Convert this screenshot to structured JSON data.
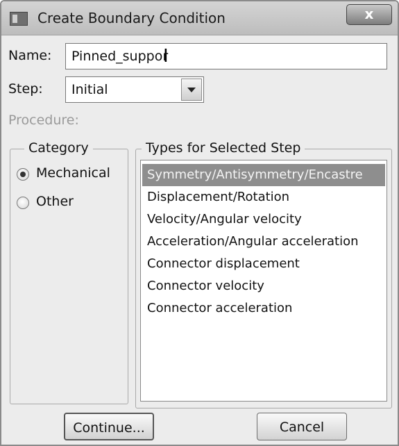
{
  "window": {
    "title": "Create Boundary Condition",
    "close_label": "x"
  },
  "form": {
    "name_label": "Name:",
    "name_value": "Pinned_suppor",
    "step_label": "Step:",
    "step_value": "Initial",
    "procedure_label": "Procedure:"
  },
  "category": {
    "title": "Category",
    "options": [
      {
        "label": "Mechanical",
        "selected": true
      },
      {
        "label": "Other",
        "selected": false
      }
    ]
  },
  "types": {
    "title": "Types for Selected Step",
    "items": [
      {
        "label": "Symmetry/Antisymmetry/Encastre",
        "selected": true
      },
      {
        "label": "Displacement/Rotation",
        "selected": false
      },
      {
        "label": "Velocity/Angular velocity",
        "selected": false
      },
      {
        "label": "Acceleration/Angular acceleration",
        "selected": false
      },
      {
        "label": "Connector displacement",
        "selected": false
      },
      {
        "label": "Connector velocity",
        "selected": false
      },
      {
        "label": "Connector acceleration",
        "selected": false
      }
    ]
  },
  "buttons": {
    "continue_label": "Continue...",
    "cancel_label": "Cancel"
  },
  "icons": {
    "app": "window-app-icon",
    "close": "close-icon",
    "dropdown": "chevron-down-icon",
    "cursor": "text-cursor-icon"
  }
}
